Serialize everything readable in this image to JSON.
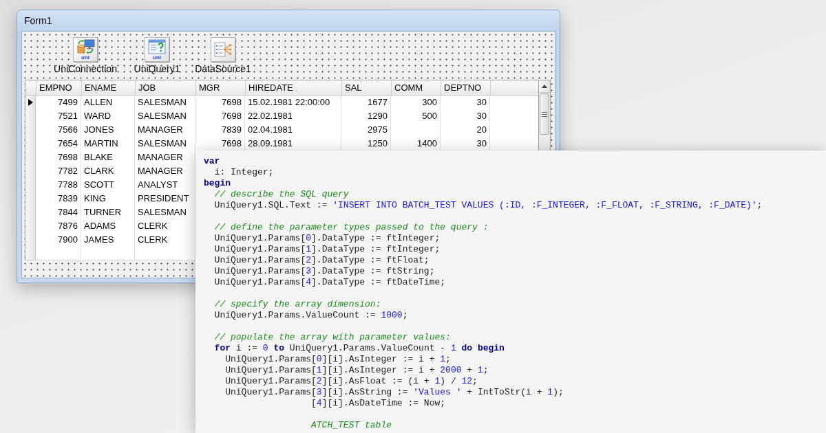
{
  "form": {
    "title": "Form1",
    "components": [
      {
        "kind": "connection",
        "label": "UniConnection",
        "badge": "uni"
      },
      {
        "kind": "query",
        "label": "UniQuery1",
        "badge": "uni"
      },
      {
        "kind": "datasource",
        "label": "DataSource1"
      }
    ],
    "grid": {
      "columns": [
        {
          "label": "EMPNO",
          "kind": "number"
        },
        {
          "label": "ENAME",
          "kind": "text"
        },
        {
          "label": "JOB",
          "kind": "text"
        },
        {
          "label": "MGR",
          "kind": "number"
        },
        {
          "label": "HIREDATE",
          "kind": "date"
        },
        {
          "label": "SAL",
          "kind": "number"
        },
        {
          "label": "COMM",
          "kind": "number"
        },
        {
          "label": "DEPTNO",
          "kind": "number"
        }
      ],
      "rows": [
        {
          "selected": true,
          "cells": [
            "7499",
            "ALLEN",
            "SALESMAN",
            "7698",
            "15.02.1981 22:00:00",
            "1677",
            "300",
            "30"
          ]
        },
        {
          "selected": false,
          "cells": [
            "7521",
            "WARD",
            "SALESMAN",
            "7698",
            "22.02.1981",
            "1290",
            "500",
            "30"
          ]
        },
        {
          "selected": false,
          "cells": [
            "7566",
            "JONES",
            "MANAGER",
            "7839",
            "02.04.1981",
            "2975",
            null,
            "20"
          ]
        },
        {
          "selected": false,
          "cells": [
            "7654",
            "MARTIN",
            "SALESMAN",
            "7698",
            "28.09.1981",
            "1250",
            "1400",
            "30"
          ]
        },
        {
          "selected": false,
          "cells": [
            "7698",
            "BLAKE",
            "MANAGER"
          ]
        },
        {
          "selected": false,
          "cells": [
            "7782",
            "CLARK",
            "MANAGER"
          ]
        },
        {
          "selected": false,
          "cells": [
            "7788",
            "SCOTT",
            "ANALYST"
          ]
        },
        {
          "selected": false,
          "cells": [
            "7839",
            "KING",
            "PRESIDENT"
          ]
        },
        {
          "selected": false,
          "cells": [
            "7844",
            "TURNER",
            "SALESMAN"
          ]
        },
        {
          "selected": false,
          "cells": [
            "7876",
            "ADAMS",
            "CLERK"
          ]
        },
        {
          "selected": false,
          "cells": [
            "7900",
            "JAMES",
            "CLERK"
          ]
        },
        {
          "selected": false,
          "cells": [
            null,
            null,
            null
          ]
        }
      ]
    }
  },
  "code_editor": {
    "blocks": [
      {
        "lines": [
          {
            "clipped_left": false,
            "segments": [
              {
                "kind": "keyword",
                "text": "var"
              }
            ]
          },
          {
            "clipped_left": false,
            "segments": [
              {
                "kind": "plain",
                "text": "  i: Integer;"
              }
            ]
          },
          {
            "clipped_left": false,
            "segments": [
              {
                "kind": "keyword",
                "text": "begin"
              }
            ]
          },
          {
            "clipped_left": false,
            "segments": [
              {
                "kind": "comment",
                "text": "  // describe the SQL query"
              }
            ]
          },
          {
            "clipped_left": false,
            "segments": [
              {
                "kind": "plain",
                "text": "  UniQuery1.SQL.Text := "
              },
              {
                "kind": "string",
                "text": "'INSERT INTO BATCH_TEST VALUES (:ID, :F_INTEGER, :F_FLOAT, :F_STRING, :F_DATE)'"
              },
              {
                "kind": "plain",
                "text": ";"
              }
            ]
          }
        ]
      },
      {
        "lines": [
          {
            "clipped_left": false,
            "segments": [
              {
                "kind": "comment",
                "text": "  // define the parameter types passed to the query :"
              }
            ]
          },
          {
            "clipped_left": false,
            "segments": [
              {
                "kind": "plain",
                "text": "  UniQuery1.Params["
              },
              {
                "kind": "number",
                "text": "0"
              },
              {
                "kind": "plain",
                "text": "].DataType := ftInteger;"
              }
            ]
          },
          {
            "clipped_left": false,
            "segments": [
              {
                "kind": "plain",
                "text": "  UniQuery1.Params["
              },
              {
                "kind": "number",
                "text": "1"
              },
              {
                "kind": "plain",
                "text": "].DataType := ftInteger;"
              }
            ]
          },
          {
            "clipped_left": false,
            "segments": [
              {
                "kind": "plain",
                "text": "  UniQuery1.Params["
              },
              {
                "kind": "number",
                "text": "2"
              },
              {
                "kind": "plain",
                "text": "].DataType := ftFloat;"
              }
            ]
          },
          {
            "clipped_left": false,
            "segments": [
              {
                "kind": "plain",
                "text": "  UniQuery1.Params["
              },
              {
                "kind": "number",
                "text": "3"
              },
              {
                "kind": "plain",
                "text": "].DataType := ftString;"
              }
            ]
          },
          {
            "clipped_left": false,
            "segments": [
              {
                "kind": "plain",
                "text": "  UniQuery1.Params["
              },
              {
                "kind": "number",
                "text": "4"
              },
              {
                "kind": "plain",
                "text": "].DataType := ftDateTime;"
              }
            ]
          }
        ]
      },
      {
        "lines": [
          {
            "clipped_left": false,
            "segments": [
              {
                "kind": "comment",
                "text": "  // specify the array dimension:"
              }
            ]
          },
          {
            "clipped_left": false,
            "segments": [
              {
                "kind": "plain",
                "text": "  UniQuery1.Params.ValueCount := "
              },
              {
                "kind": "number",
                "text": "1000"
              },
              {
                "kind": "plain",
                "text": ";"
              }
            ]
          }
        ]
      },
      {
        "lines": [
          {
            "clipped_left": false,
            "segments": [
              {
                "kind": "comment",
                "text": "  // populate the array with parameter values:"
              }
            ]
          },
          {
            "clipped_left": false,
            "segments": [
              {
                "kind": "keyword",
                "text": "  for"
              },
              {
                "kind": "plain",
                "text": " i := "
              },
              {
                "kind": "number",
                "text": "0"
              },
              {
                "kind": "keyword",
                "text": " to"
              },
              {
                "kind": "plain",
                "text": " UniQuery1.Params.ValueCount - "
              },
              {
                "kind": "number",
                "text": "1"
              },
              {
                "kind": "keyword",
                "text": " do begin"
              }
            ]
          },
          {
            "clipped_left": false,
            "segments": [
              {
                "kind": "plain",
                "text": "    UniQuery1.Params["
              },
              {
                "kind": "number",
                "text": "0"
              },
              {
                "kind": "plain",
                "text": "][i].AsInteger := i + "
              },
              {
                "kind": "number",
                "text": "1"
              },
              {
                "kind": "plain",
                "text": ";"
              }
            ]
          },
          {
            "clipped_left": false,
            "segments": [
              {
                "kind": "plain",
                "text": "    UniQuery1.Params["
              },
              {
                "kind": "number",
                "text": "1"
              },
              {
                "kind": "plain",
                "text": "][i].AsInteger := i + "
              },
              {
                "kind": "number",
                "text": "2000"
              },
              {
                "kind": "plain",
                "text": " + "
              },
              {
                "kind": "number",
                "text": "1"
              },
              {
                "kind": "plain",
                "text": ";"
              }
            ]
          },
          {
            "clipped_left": false,
            "segments": [
              {
                "kind": "plain",
                "text": "    UniQuery1.Params["
              },
              {
                "kind": "number",
                "text": "2"
              },
              {
                "kind": "plain",
                "text": "][i].AsFloat := (i + "
              },
              {
                "kind": "number",
                "text": "1"
              },
              {
                "kind": "plain",
                "text": ") / "
              },
              {
                "kind": "number",
                "text": "12"
              },
              {
                "kind": "plain",
                "text": ";"
              }
            ]
          },
          {
            "clipped_left": false,
            "segments": [
              {
                "kind": "plain",
                "text": "    UniQuery1.Params["
              },
              {
                "kind": "number",
                "text": "3"
              },
              {
                "kind": "plain",
                "text": "][i].AsString := "
              },
              {
                "kind": "string",
                "text": "'Values '"
              },
              {
                "kind": "plain",
                "text": " + IntToStr(i + "
              },
              {
                "kind": "number",
                "text": "1"
              },
              {
                "kind": "plain",
                "text": ");"
              }
            ]
          },
          {
            "clipped_left": true,
            "segments": [
              {
                "kind": "plain",
                "text": "["
              },
              {
                "kind": "number",
                "text": "4"
              },
              {
                "kind": "plain",
                "text": "][i].AsDateTime := Now;"
              }
            ]
          }
        ]
      },
      {
        "lines": [
          {
            "clipped_left": true,
            "segments": [
              {
                "kind": "comment",
                "text": "ATCH_TEST table"
              }
            ]
          }
        ]
      }
    ]
  }
}
